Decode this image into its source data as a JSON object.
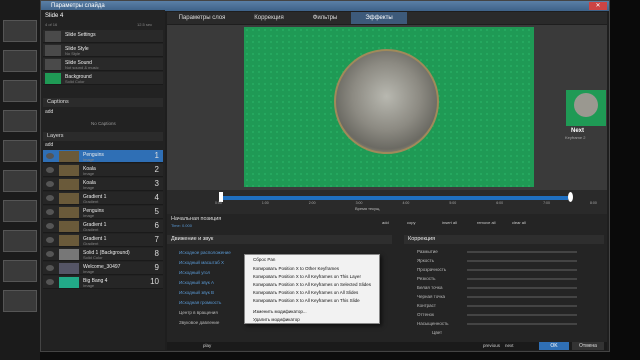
{
  "window": {
    "title": "Параметры слайда"
  },
  "slide": {
    "name": "Slide 4",
    "counter": "4 of 16",
    "duration": "12.5 sec"
  },
  "slide_rows": [
    {
      "title": "Slide Settings",
      "sub": "",
      "num": "",
      "icon": "settings-icon"
    },
    {
      "title": "Slide Style",
      "sub": "No Style",
      "num": ""
    },
    {
      "title": "Slide Sound",
      "sub": "Not sound & music",
      "num": ""
    },
    {
      "title": "Background",
      "sub": "Solid Color",
      "num": ""
    }
  ],
  "captions": {
    "header": "Captions",
    "add": "add",
    "none": "No Captions"
  },
  "layers": {
    "header": "Layers",
    "add": "add",
    "items": [
      {
        "title": "Penguins",
        "sub": "Image",
        "num": "1",
        "selected": true
      },
      {
        "title": "Koala",
        "sub": "Image",
        "num": "2"
      },
      {
        "title": "Koala",
        "sub": "Image",
        "num": "3"
      },
      {
        "title": "Gradient 1",
        "sub": "Gradient",
        "num": "4"
      },
      {
        "title": "Penguins",
        "sub": "Image",
        "num": "5"
      },
      {
        "title": "Gradient 1",
        "sub": "Gradient",
        "num": "6"
      },
      {
        "title": "Gradient 1",
        "sub": "Gradient",
        "num": "7"
      },
      {
        "title": "Solid 1 (Background)",
        "sub": "Solid Color",
        "num": "8"
      },
      {
        "title": "Welcome_30497",
        "sub": "Image",
        "num": "9"
      },
      {
        "title": "Big Bang 4",
        "sub": "Image",
        "num": "10"
      }
    ]
  },
  "tabs": [
    "Параметры слоя",
    "Коррекция",
    "Фильтры",
    "Эффекты"
  ],
  "active_tab": 3,
  "next_slide": {
    "label": "Next",
    "sub": "Keyframe 2"
  },
  "timeline": {
    "ticks": [
      "0:00",
      "1:00",
      "2:00",
      "3:00",
      "4:00",
      "5:00",
      "6:00",
      "7:00",
      "8:00"
    ],
    "marker": "Время текущ.",
    "progress": 0.93
  },
  "position": {
    "title": "Начальная позиция",
    "sub": "Time: 0.000"
  },
  "toolbar": {
    "add": "add",
    "copy": "copy",
    "insert": "insert all",
    "remove": "remove all",
    "clear": "clear all"
  },
  "motion": {
    "header": "Движение и звук",
    "props": [
      "Исходное расположение",
      "Исходный масштаб Х",
      "Исходный угол",
      "Исходный звук А",
      "Исходный звук В",
      "Исходная громкость"
    ],
    "center": "Центр в вращения",
    "volume": "Звуковое давление"
  },
  "context_menu": {
    "items": [
      "Сброс Pan",
      "Копировать Position X to Other Keyframes",
      "Копировать Position X to All Keyframes on This Layer",
      "Копировать Position X to All Keyframes on Selected Slides",
      "Копировать Position X to All Keyframes on All Slides",
      "Копировать Position X to All Keyframes on This Slide",
      "Изменить модификатор...",
      "Удалить модификатор"
    ]
  },
  "correction": {
    "header": "Коррекция",
    "props": [
      "Размытие",
      "Яркость",
      "Прозрачность",
      "Резкость",
      "Белая точка",
      "Черная точка",
      "Контраст",
      "Оттенок",
      "Насыщенность"
    ],
    "color": "Цвет"
  },
  "footer": {
    "play": "play",
    "prev": "previous",
    "next": "next",
    "ok": "OK",
    "cancel": "Отмена"
  },
  "colors": {
    "accent": "#2f6fb5",
    "canvas": "#1f9a55",
    "ok": "#2f6fb5"
  }
}
